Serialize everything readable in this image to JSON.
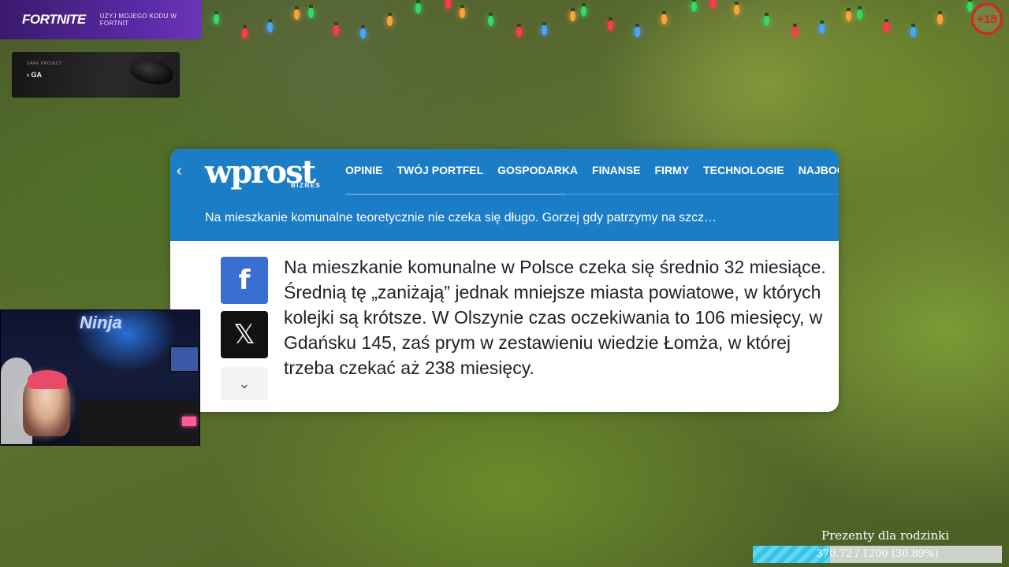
{
  "overlay": {
    "fortnite": {
      "logo": "FORTNITE",
      "code_text": "UŻYJ MOJEGO KODU W FORTNIT"
    },
    "dark_project": {
      "brand": "DARK PROJECT",
      "product": "› GA"
    },
    "age_badge": "+18",
    "goal": {
      "label": "Prezenty dla rodzinki",
      "progress_text": "370.72 / 1200 (30.89%)",
      "progress_fraction": 0.3089
    }
  },
  "article": {
    "site_logo": "wprost",
    "site_sub": "BIZNES",
    "nav": [
      "OPINIE",
      "TWÓJ PORTFEL",
      "GOSPODARKA",
      "FINANSE",
      "FIRMY",
      "TECHNOLOGIE",
      "NAJBOGATSI"
    ],
    "headline": "Na mieszkanie komunalne teoretycznie nie czeka się długo. Gorzej gdy patrzymy na szcz…",
    "share": {
      "facebook": "f",
      "x": "𝕏",
      "more": "⌄"
    },
    "body": "Na mieszkanie komunalne w Polsce czeka się średnio 32 miesiące. Średnią tę „zaniżają” jednak mniejsze miasta powiatowe, w których kolejki są krótsze. W Olszynie czas oczekiwania to 106 miesięcy, w Gdańsku 145, zaś prym w zestawieniu wiedzie Łomża, w której trzeba czekać aż 238 miesięcy."
  },
  "webcam": {
    "sign": "Ninja"
  },
  "colors": {
    "wprost_blue": "#1b7dc6",
    "fortnite_purple": "#5b2aa6",
    "goal_cyan": "#35c4e8"
  }
}
